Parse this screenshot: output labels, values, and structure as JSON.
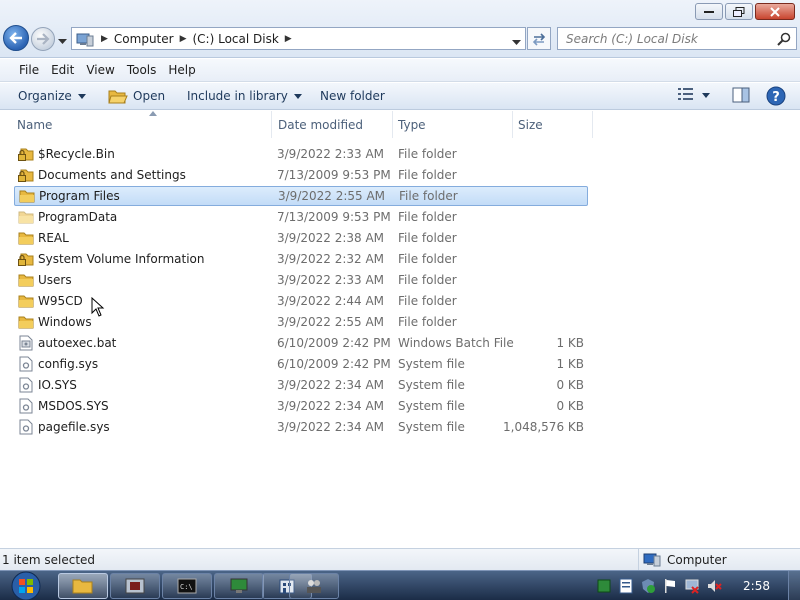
{
  "window": {
    "address_crumbs": [
      "Computer",
      "(C:) Local Disk"
    ],
    "search_placeholder": "Search (C:) Local Disk"
  },
  "menu": [
    {
      "label": "File"
    },
    {
      "label": "Edit"
    },
    {
      "label": "View"
    },
    {
      "label": "Tools"
    },
    {
      "label": "Help"
    }
  ],
  "toolbar": {
    "organize": "Organize",
    "open": "Open",
    "include_in_library": "Include in library",
    "new_folder": "New folder"
  },
  "columns": {
    "name": "Name",
    "date": "Date modified",
    "type": "Type",
    "size": "Size"
  },
  "files": [
    {
      "name": "$Recycle.Bin",
      "date": "3/9/2022 2:33 AM",
      "type": "File folder",
      "size": "",
      "icon": "locked-folder-icon"
    },
    {
      "name": "Documents and Settings",
      "date": "7/13/2009 9:53 PM",
      "type": "File folder",
      "size": "",
      "icon": "locked-folder-icon"
    },
    {
      "name": "Program Files",
      "date": "3/9/2022 2:55 AM",
      "type": "File folder",
      "size": "",
      "icon": "folder-icon",
      "selected": true
    },
    {
      "name": "ProgramData",
      "date": "7/13/2009 9:53 PM",
      "type": "File folder",
      "size": "",
      "icon": "hidden-folder-icon"
    },
    {
      "name": "REAL",
      "date": "3/9/2022 2:38 AM",
      "type": "File folder",
      "size": "",
      "icon": "folder-icon"
    },
    {
      "name": "System Volume Information",
      "date": "3/9/2022 2:32 AM",
      "type": "File folder",
      "size": "",
      "icon": "locked-folder-icon"
    },
    {
      "name": "Users",
      "date": "3/9/2022 2:33 AM",
      "type": "File folder",
      "size": "",
      "icon": "folder-icon"
    },
    {
      "name": "W95CD",
      "date": "3/9/2022 2:44 AM",
      "type": "File folder",
      "size": "",
      "icon": "folder-icon"
    },
    {
      "name": "Windows",
      "date": "3/9/2022 2:55 AM",
      "type": "File folder",
      "size": "",
      "icon": "folder-icon"
    },
    {
      "name": "autoexec.bat",
      "date": "6/10/2009 2:42 PM",
      "type": "Windows Batch File",
      "size": "1 KB",
      "icon": "batch-file-icon"
    },
    {
      "name": "config.sys",
      "date": "6/10/2009 2:42 PM",
      "type": "System file",
      "size": "1 KB",
      "icon": "system-file-icon"
    },
    {
      "name": "IO.SYS",
      "date": "3/9/2022 2:34 AM",
      "type": "System file",
      "size": "0 KB",
      "icon": "system-file-icon"
    },
    {
      "name": "MSDOS.SYS",
      "date": "3/9/2022 2:34 AM",
      "type": "System file",
      "size": "0 KB",
      "icon": "system-file-icon"
    },
    {
      "name": "pagefile.sys",
      "date": "3/9/2022 2:34 AM",
      "type": "System file",
      "size": "1,048,576 KB",
      "icon": "system-file-icon"
    }
  ],
  "status": {
    "selection": "1 item selected",
    "location": "Computer"
  },
  "taskbar": {
    "clock": "2:58"
  },
  "colors": {
    "selection_fill": "#c3dcf7",
    "selection_border": "#84acdd",
    "folder_yellow": "#e8b840",
    "taskbar_dark": "#1b2c47"
  }
}
